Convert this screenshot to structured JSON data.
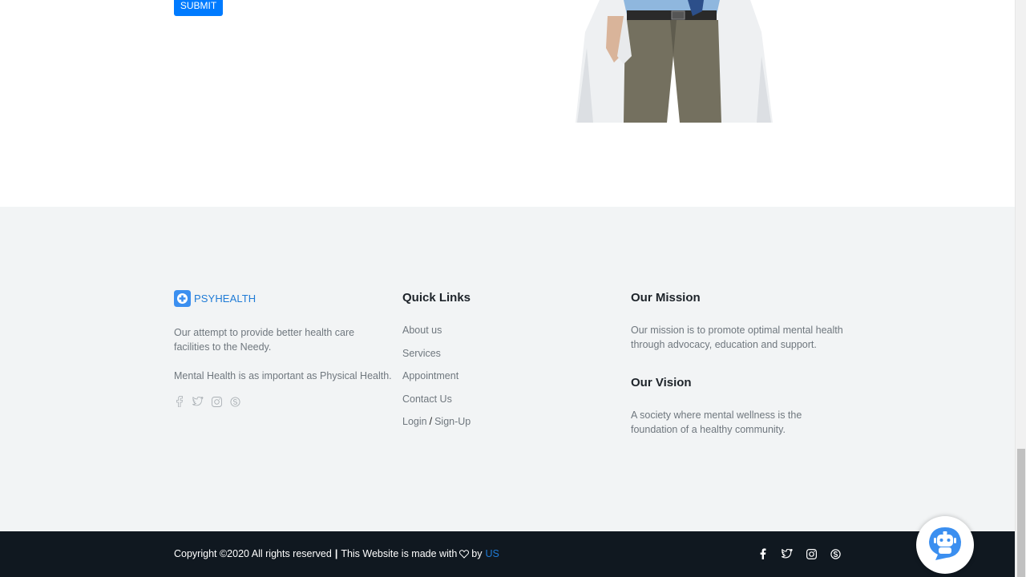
{
  "form": {
    "submit_label": "SUBMIT"
  },
  "brand": {
    "name": "PSYHEALTH",
    "logo_icon": "plus-icon",
    "accent": "#1f7bd6"
  },
  "about": {
    "text1": "Our attempt to provide better health care facilities to the Needy.",
    "text2": "Mental Health is as important as Physical Health.",
    "social": [
      "facebook-icon",
      "twitter-icon",
      "instagram-icon",
      "skype-icon"
    ]
  },
  "quick_links": {
    "heading": "Quick Links",
    "items": [
      "About us",
      "Services",
      "Appointment",
      "Contact Us"
    ],
    "login": "Login",
    "separator": "/",
    "signup": "Sign-Up"
  },
  "mission": {
    "heading": "Our Mission",
    "text": "Our mission is to promote optimal mental health through advocacy, education and support."
  },
  "vision": {
    "heading": "Our Vision",
    "text": "A society where mental wellness is the foundation of a healthy community."
  },
  "bottom": {
    "copyright": "Copyright ©2020 All rights reserved",
    "pipe": "|",
    "made_with": "This Website is made with",
    "by": "by",
    "us": "US",
    "social": [
      "facebook-icon",
      "twitter-icon",
      "instagram-icon",
      "skype-icon"
    ]
  },
  "chatbot": {
    "icon": "chatbot-icon"
  },
  "colors": {
    "primary": "#007bff",
    "footer_bg": "#f2f4f5",
    "bottom_bg": "#101820"
  }
}
